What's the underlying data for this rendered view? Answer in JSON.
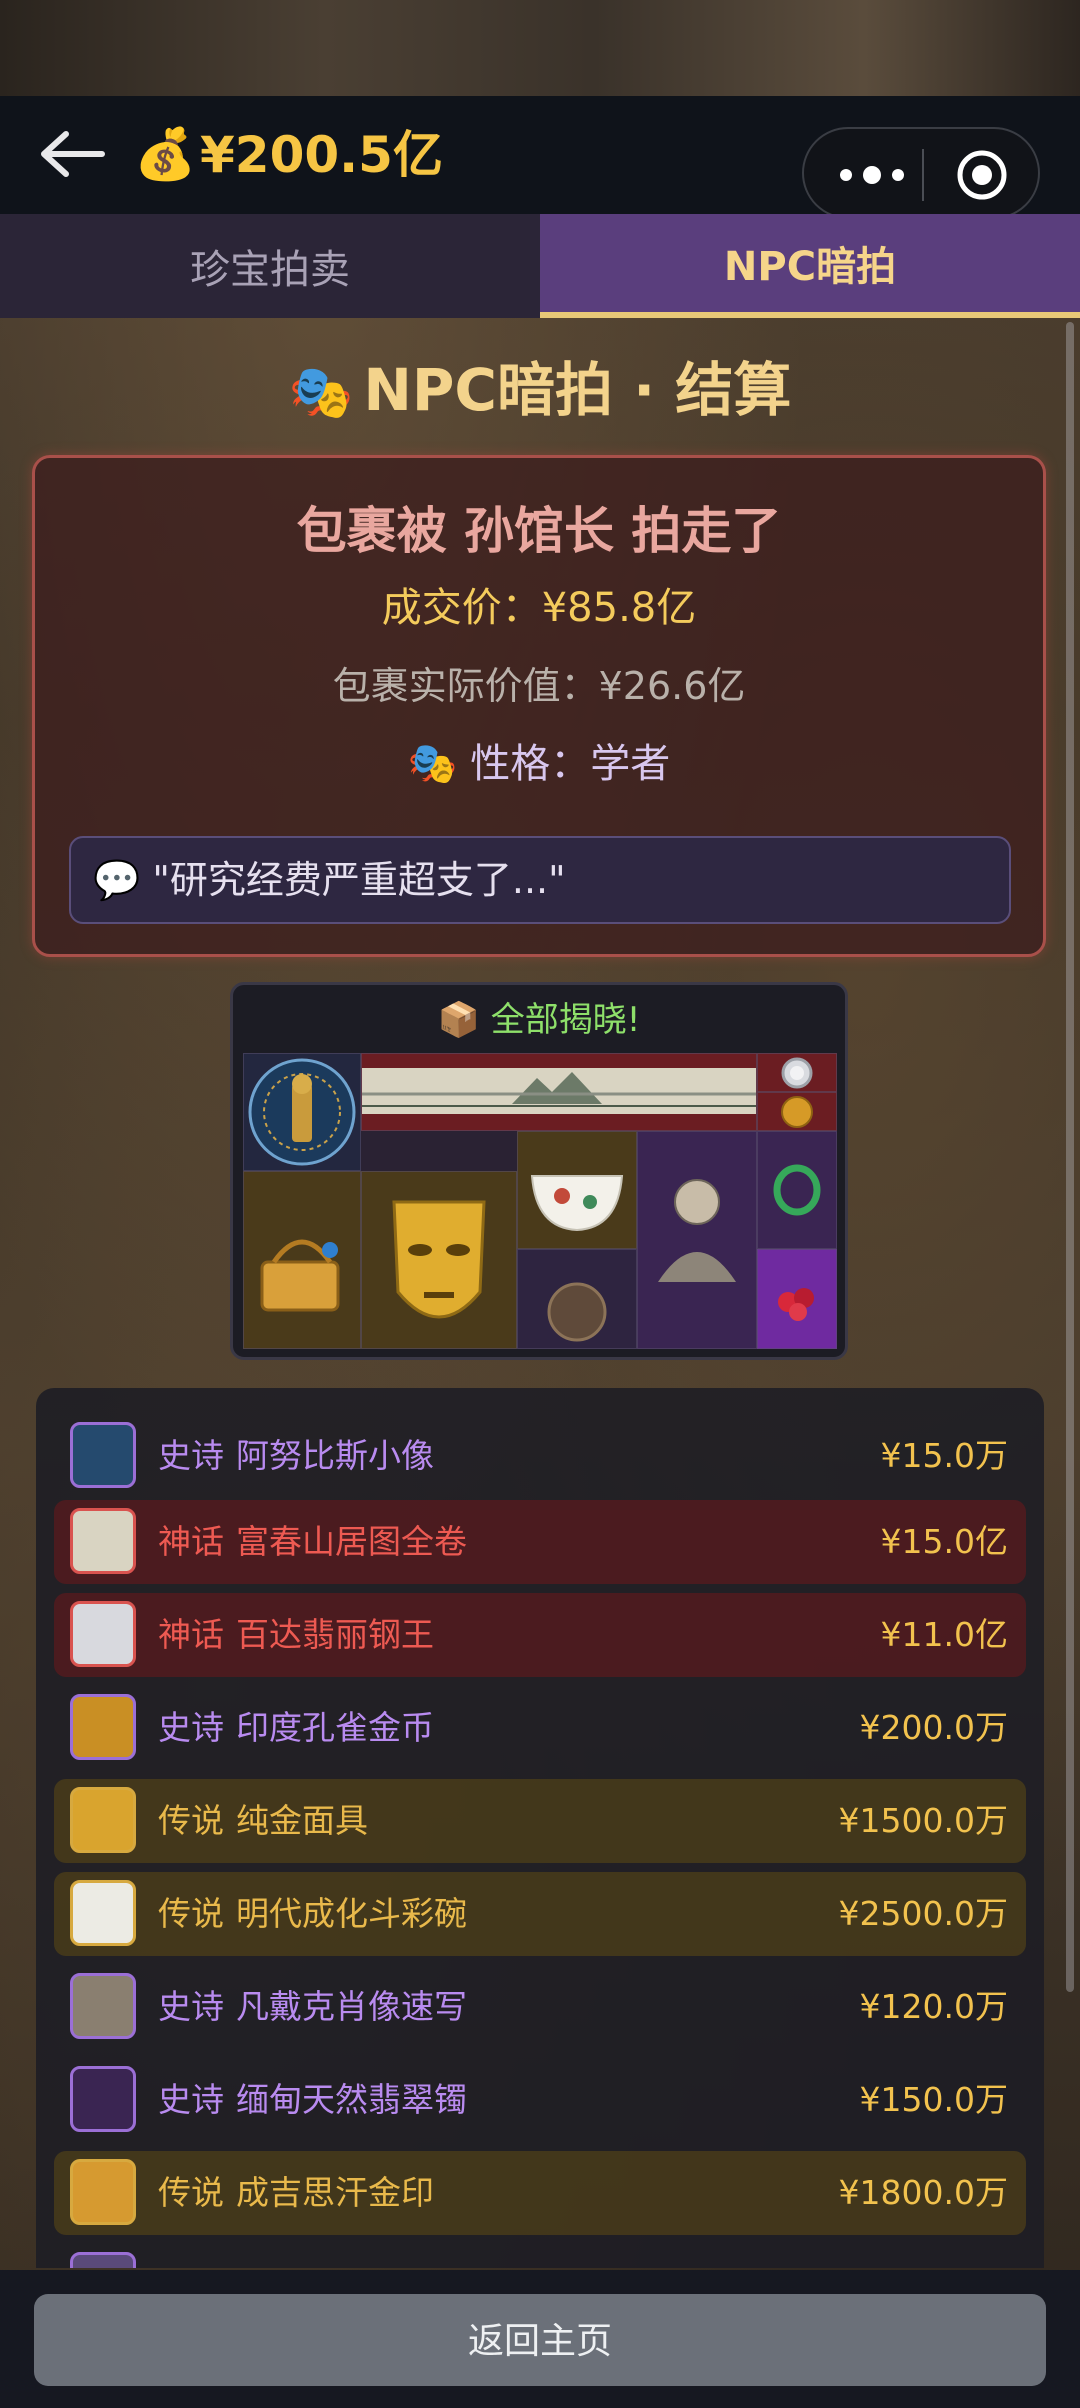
{
  "header": {
    "balance": "¥200.5亿",
    "money_icon": "💰"
  },
  "tabs": [
    {
      "label": "珍宝拍卖",
      "active": false
    },
    {
      "label": "NPC暗拍",
      "active": true
    }
  ],
  "page_title": "NPC暗拍 · 结算",
  "title_icon": "🎭",
  "result": {
    "headline": "包裹被 孙馆长 拍走了",
    "deal_price": "成交价：¥85.8亿",
    "real_value": "包裹实际价值：¥26.6亿",
    "personality_icon": "🎭",
    "personality": "性格：学者",
    "quote_icon": "💬",
    "quote": "\"研究经费严重超支了...\""
  },
  "reveal": {
    "icon": "📦",
    "title": "全部揭晓!"
  },
  "items": [
    {
      "rarity": "史诗",
      "name": "阿努比斯小像",
      "price": "¥15.0万",
      "tier": "epic"
    },
    {
      "rarity": "神话",
      "name": "富春山居图全卷",
      "price": "¥15.0亿",
      "tier": "myth"
    },
    {
      "rarity": "神话",
      "name": "百达翡丽钢王",
      "price": "¥11.0亿",
      "tier": "myth"
    },
    {
      "rarity": "史诗",
      "name": "印度孔雀金币",
      "price": "¥200.0万",
      "tier": "epic"
    },
    {
      "rarity": "传说",
      "name": "纯金面具",
      "price": "¥1500.0万",
      "tier": "legend"
    },
    {
      "rarity": "传说",
      "name": "明代成化斗彩碗",
      "price": "¥2500.0万",
      "tier": "legend"
    },
    {
      "rarity": "史诗",
      "name": "凡戴克肖像速写",
      "price": "¥120.0万",
      "tier": "epic"
    },
    {
      "rarity": "史诗",
      "name": "缅甸天然翡翠镯",
      "price": "¥150.0万",
      "tier": "epic"
    },
    {
      "rarity": "传说",
      "name": "成吉思汗金印",
      "price": "¥1800.0万",
      "tier": "legend"
    }
  ],
  "tier_colors": {
    "epic": "#9b6fd6",
    "myth": "#d9534f",
    "legend": "#d7a93f"
  },
  "footer": {
    "home_button": "返回主页"
  }
}
